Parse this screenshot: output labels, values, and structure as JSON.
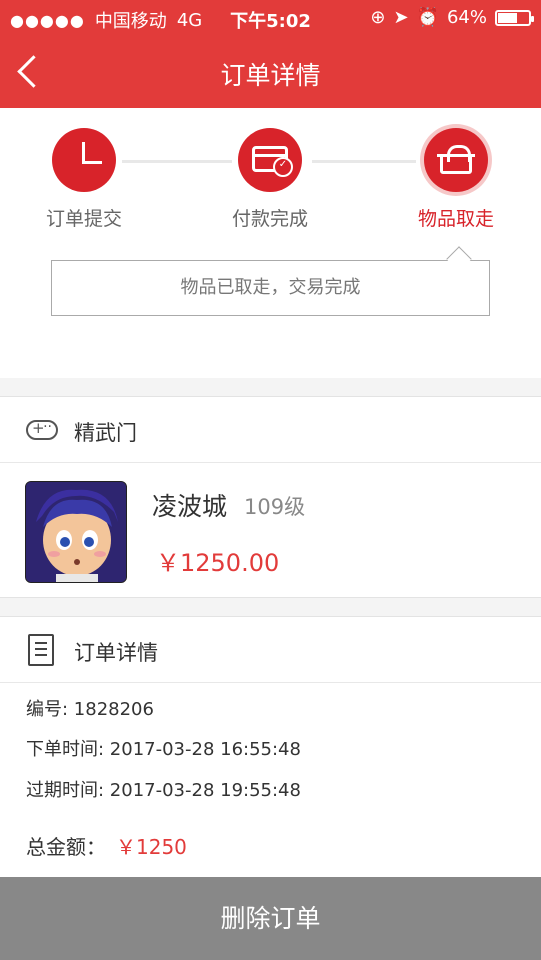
{
  "status_bar": {
    "carrier": "中国移动",
    "network": "4G",
    "time": "下午5:02",
    "battery": "64%",
    "battery_level": 0.64
  },
  "header": {
    "title": "订单详情"
  },
  "progress": {
    "steps": [
      {
        "label": "订单提交",
        "icon": "clock-icon"
      },
      {
        "label": "付款完成",
        "icon": "card-icon"
      },
      {
        "label": "物品取走",
        "icon": "basket-icon"
      }
    ],
    "active_step": 2,
    "message": "物品已取走，交易完成"
  },
  "shop": {
    "icon": "gamepad-icon",
    "name": "精武门",
    "product": {
      "name": "凌波城",
      "level": "109级",
      "price": "￥1250.00"
    }
  },
  "order": {
    "icon": "document-icon",
    "title": "订单详情",
    "number_label": "编号: 1828206",
    "created_label": "下单时间: 2017-03-28 16:55:48",
    "expires_label": "过期时间: 2017-03-28 19:55:48",
    "total_label": "总金额：",
    "total_amount": "￥1250"
  },
  "actions": {
    "delete_label": "删除订单"
  },
  "colors": {
    "accent": "#e23b3a",
    "step_red": "#d8232a",
    "button_gray": "#888888"
  }
}
